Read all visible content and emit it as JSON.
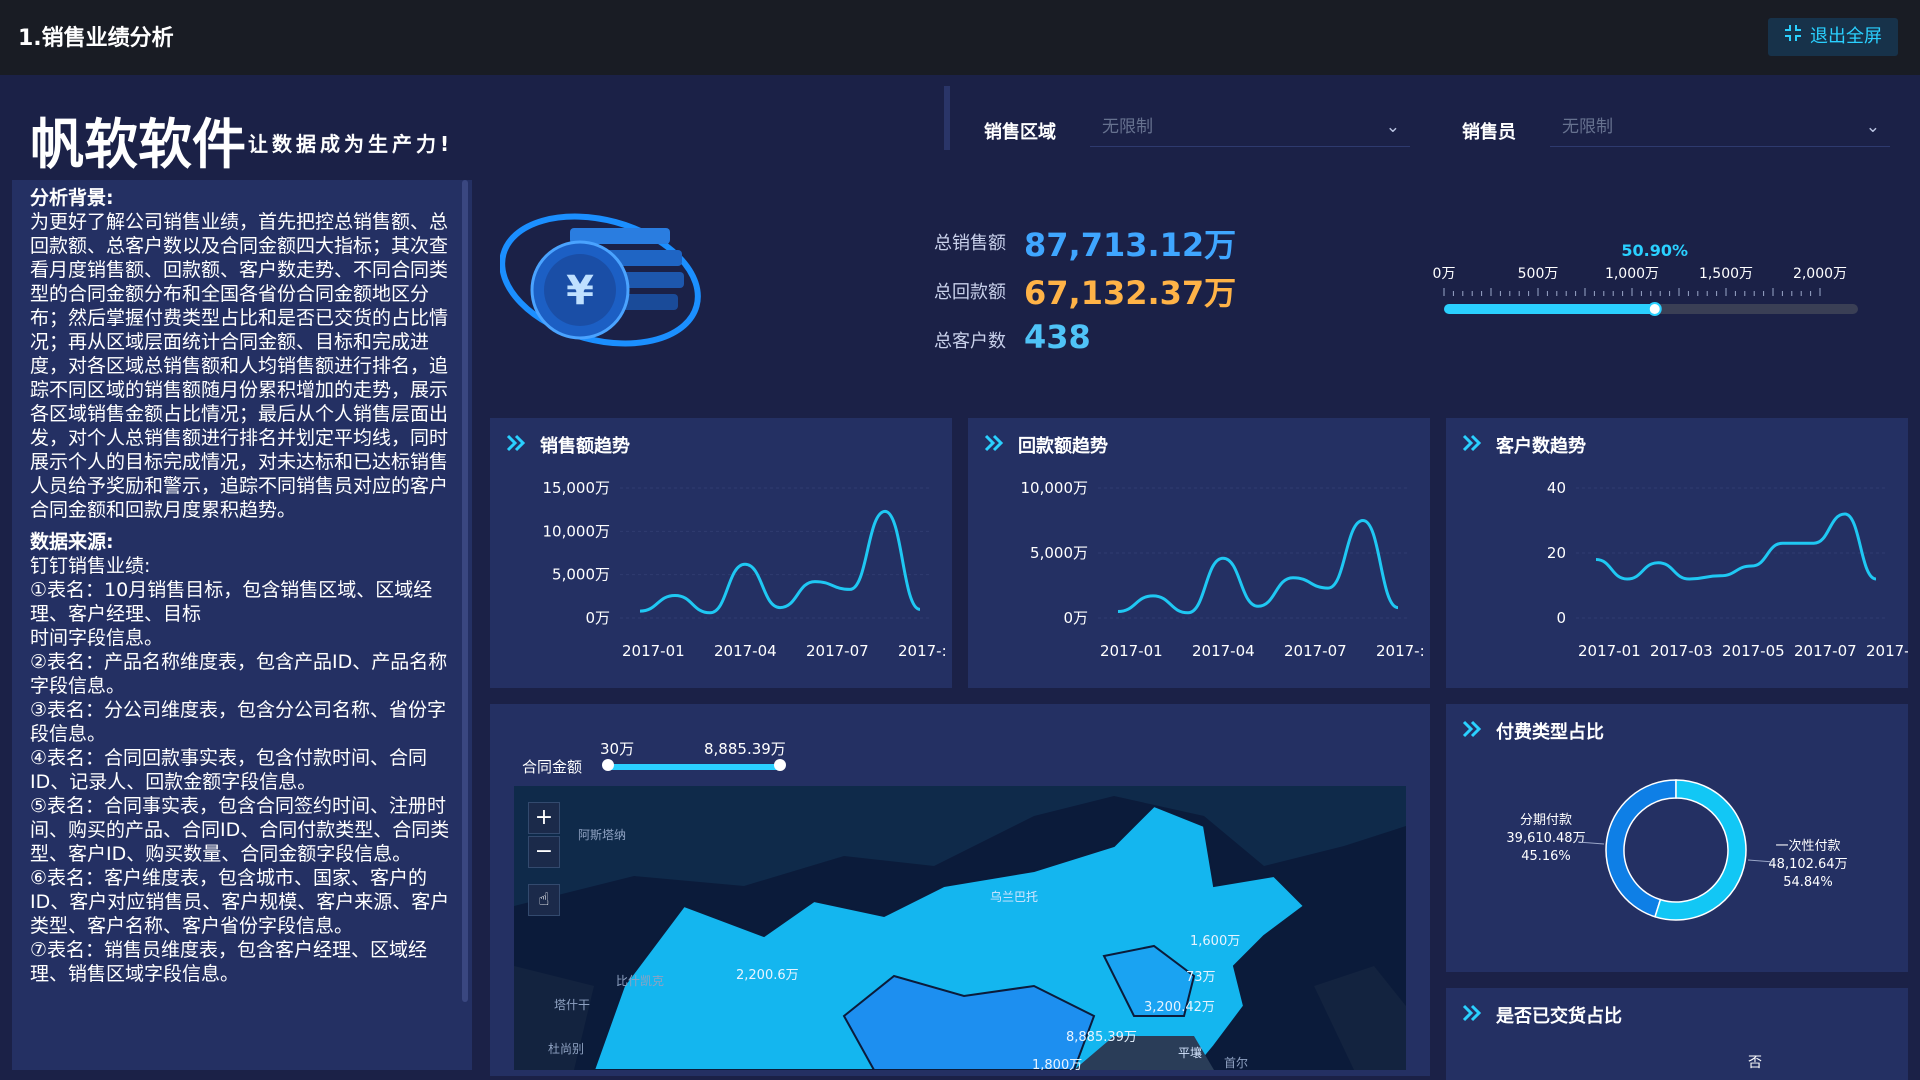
{
  "header": {
    "title": "1.销售业绩分析",
    "exit_label": "退出全屏"
  },
  "brand": {
    "name": "帆软软件",
    "slogan": "让数据成为生产力!"
  },
  "filters": {
    "region_label": "销售区域",
    "region_value": "无限制",
    "seller_label": "销售员",
    "seller_value": "无限制"
  },
  "background": {
    "heading1": "分析背景:",
    "body1": "为更好了解公司销售业绩，首先把控总销售额、总回款额、总客户数以及合同金额四大指标；其次查看月度销售额、回款额、客户数走势、不同合同类型的合同金额分布和全国各省份合同金额地区分布；然后掌握付费类型占比和是否已交货的占比情况；再从区域层面统计合同金额、目标和完成进度，对各区域总销售额和人均销售额进行排名，追踪不同区域的销售额随月份累积增加的走势，展示各区域销售金额占比情况；最后从个人销售层面出发，对个人总销售额进行排名并划定平均线，同时展示个人的目标完成情况，对未达标和已达标销售人员给予奖励和警示，追踪不同销售员对应的客户合同金额和回款月度累积趋势。",
    "heading2": "数据来源:",
    "source_intro": "钉钉销售业绩:",
    "sources": [
      "①表名：10月销售目标，包含销售区域、区域经理、客户经理、目标",
      "时间字段信息。",
      "②表名：产品名称维度表，包含产品ID、产品名称字段信息。",
      "③表名：分公司维度表，包含分公司名称、省份字段信息。",
      "④表名：合同回款事实表，包含付款时间、合同ID、记录人、回款金额字段信息。",
      "⑤表名：合同事实表，包含合同签约时间、注册时间、购买的产品、合同ID、合同付款类型、合同类型、客户ID、购买数量、合同金额字段信息。",
      "⑥表名：客户维度表，包含城市、国家、客户的ID、客户对应销售员、客户规模、客户来源、客户类型、客户名称、客户省份字段信息。",
      "⑦表名：销售员维度表，包含客户经理、区域经理、销售区域字段信息。"
    ]
  },
  "kpis": {
    "sales_label": "总销售额",
    "sales_value": "87,713.12万",
    "sales_color": "#3fa6ff",
    "payback_label": "总回款额",
    "payback_value": "67,132.37万",
    "payback_color": "#ffb347",
    "customers_label": "总客户数",
    "customers_value": "438",
    "customers_color": "#4fc3f7"
  },
  "gauge": {
    "percent_label": "50.90%",
    "percent": 0.509,
    "ticks": [
      "0万",
      "500万",
      "1,000万",
      "1,500万",
      "2,000万"
    ]
  },
  "charts": {
    "sales_title": "销售额趋势",
    "payback_title": "回款额趋势",
    "customers_title": "客户数趋势",
    "paytype_title": "付费类型占比",
    "delivered_title": "是否已交货占比",
    "delivered_partial_label": "否"
  },
  "chart_data": [
    {
      "type": "line",
      "title": "销售额趋势",
      "x": [
        "2017-01",
        "2017-02",
        "2017-03",
        "2017-04",
        "2017-05",
        "2017-06",
        "2017-07",
        "2017-08",
        "2017-09",
        "2017-10"
      ],
      "x_tick_labels": [
        "2017-01",
        "2017-04",
        "2017-07",
        "2017-:"
      ],
      "y_tick_labels": [
        "15,000万",
        "10,000万",
        "5,000万",
        "0万"
      ],
      "values": [
        800,
        2600,
        600,
        6200,
        1200,
        4200,
        3300,
        12300,
        1000
      ],
      "ylim": [
        0,
        15000
      ],
      "color": "#1fc8f3"
    },
    {
      "type": "line",
      "title": "回款额趋势",
      "x": [
        "2017-01",
        "2017-02",
        "2017-03",
        "2017-04",
        "2017-05",
        "2017-06",
        "2017-07",
        "2017-08",
        "2017-09",
        "2017-10"
      ],
      "x_tick_labels": [
        "2017-01",
        "2017-04",
        "2017-07",
        "2017-:"
      ],
      "y_tick_labels": [
        "10,000万",
        "5,000万",
        "0万"
      ],
      "values": [
        500,
        1700,
        400,
        4600,
        900,
        3100,
        2300,
        7500,
        800
      ],
      "ylim": [
        0,
        10000
      ],
      "color": "#1fc8f3"
    },
    {
      "type": "line",
      "title": "客户数趋势",
      "x": [
        "2017-01",
        "2017-02",
        "2017-03",
        "2017-04",
        "2017-05",
        "2017-06",
        "2017-07",
        "2017-08",
        "2017-09",
        "2017-10"
      ],
      "x_tick_labels": [
        "2017-01",
        "2017-03",
        "2017-05",
        "2017-07",
        "2017-09"
      ],
      "y_tick_labels": [
        "40",
        "20",
        "0"
      ],
      "values": [
        18,
        12,
        17,
        12,
        13,
        16,
        23,
        23,
        32,
        12
      ],
      "ylim": [
        0,
        40
      ],
      "color": "#1fc8f3"
    },
    {
      "type": "pie",
      "title": "付费类型占比",
      "slices": [
        {
          "name": "分期付款",
          "value": 39610.48,
          "label": "39,610.48万",
          "pct": "45.16%",
          "color": "#0e7fe6"
        },
        {
          "name": "一次性付款",
          "value": 48102.64,
          "label": "48,102.64万",
          "pct": "54.84%",
          "color": "#12c7f5"
        }
      ]
    }
  ],
  "map": {
    "range_label": "合同金额",
    "range_min": "30万",
    "range_max": "8,885.39万",
    "zoom_in": "+",
    "zoom_out": "−",
    "place_labels": [
      "阿斯塔纳",
      "乌兰巴托",
      "比什凯克",
      "塔什干",
      "杜尚别",
      "平壤",
      "首尔"
    ],
    "value_labels": [
      "2,200.6万",
      "1,600万",
      "73万",
      "3,200.42万",
      "8,885.39万",
      "1,800万"
    ]
  }
}
